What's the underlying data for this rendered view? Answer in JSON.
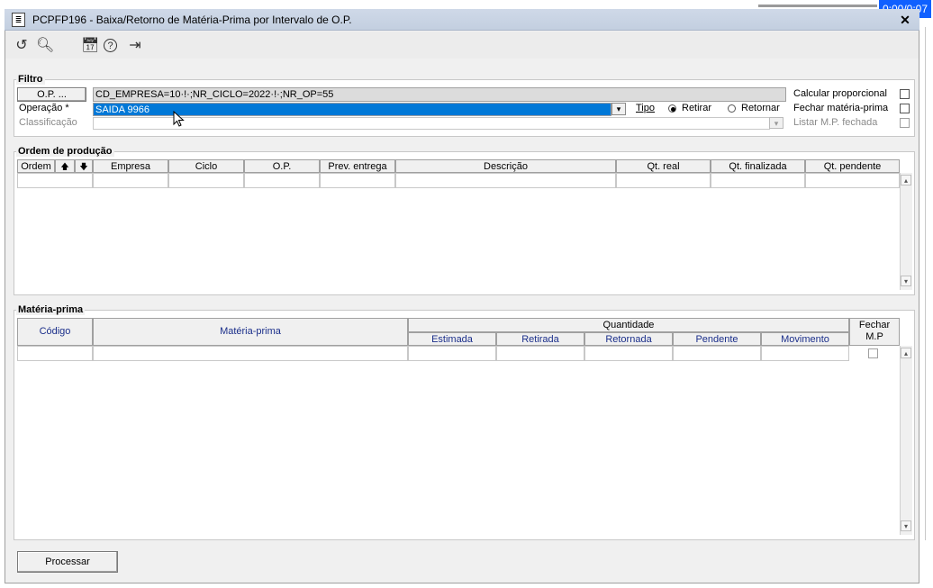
{
  "timer": "0:00/0:07",
  "window": {
    "title": "PCPFP196 - Baixa/Retorno de Matéria-Prima por Intervalo de O.P.",
    "close": "✕"
  },
  "toolbar": {
    "refresh": "↺",
    "search": "🔍︎",
    "calendar": "📅︎",
    "help": "?",
    "exit": "⇥"
  },
  "filtro": {
    "title": "Filtro",
    "op_button": "O.P. ...",
    "op_value": "CD_EMPRESA=10·!·;NR_CICLO=2022·!·;NR_OP=55",
    "operacao_label": "Operação *",
    "operacao_value": "SAIDA 9966",
    "classificacao_label": "Classificação",
    "classificacao_value": "",
    "tipo_label": "Tipo",
    "tipo_retirar": "Retirar",
    "tipo_retornar": "Retornar",
    "tipo_selected": "Retirar",
    "calcular_label": "Calcular proporcional",
    "fechar_label": "Fechar matéria-prima",
    "listar_label": "Listar M.P. fechada"
  },
  "ordem": {
    "title": "Ordem de produção",
    "columns": [
      "Ordem",
      "Empresa",
      "Ciclo",
      "O.P.",
      "Prev. entrega",
      "Descrição",
      "Qt. real",
      "Qt. finalizada",
      "Qt. pendente"
    ],
    "sort_up": "🡅",
    "sort_down": "🡇"
  },
  "materia": {
    "title": "Matéria-prima",
    "col_codigo": "Código",
    "col_materia": "Matéria-prima",
    "col_quantidade": "Quantidade",
    "sub_columns": [
      "Estimada",
      "Retirada",
      "Retornada",
      "Pendente",
      "Movimento"
    ],
    "col_fechar": "Fechar M.P"
  },
  "actions": {
    "processar": "Processar"
  }
}
